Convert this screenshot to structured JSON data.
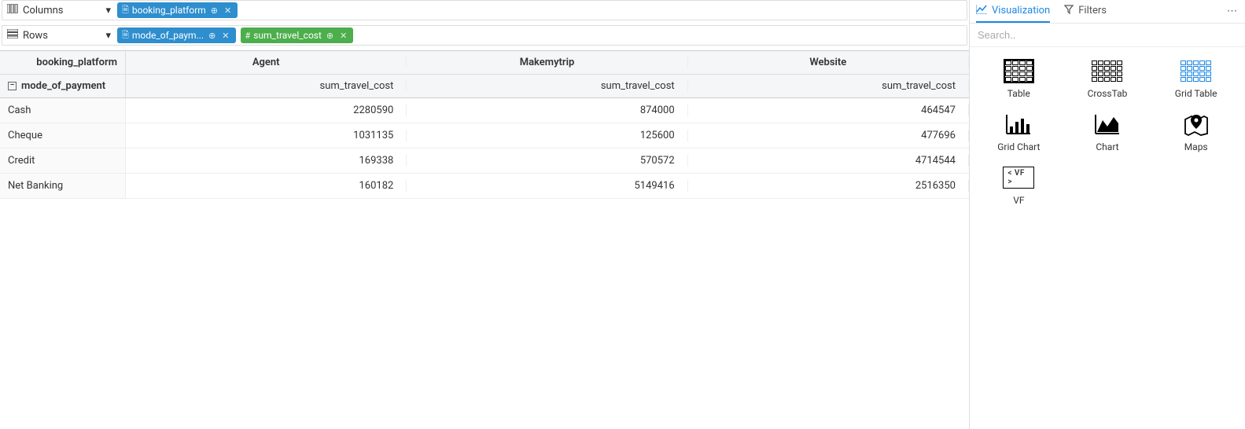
{
  "shelves": {
    "columns": {
      "label": "Columns",
      "pills": [
        {
          "text": "booking_platform",
          "color": "blue"
        }
      ]
    },
    "rows": {
      "label": "Rows",
      "pills": [
        {
          "text": "mode_of_paym...",
          "color": "blue"
        },
        {
          "text": "sum_travel_cost",
          "color": "green"
        }
      ]
    }
  },
  "crosstab": {
    "col_dimension": "booking_platform",
    "row_dimension": "mode_of_payment",
    "measure_label": "sum_travel_cost",
    "columns": [
      "Agent",
      "Makemytrip",
      "Website"
    ],
    "rows": [
      {
        "label": "Cash",
        "values": [
          "2280590",
          "874000",
          "464547"
        ]
      },
      {
        "label": "Cheque",
        "values": [
          "1031135",
          "125600",
          "477696"
        ]
      },
      {
        "label": "Credit",
        "values": [
          "169338",
          "570572",
          "4714544"
        ]
      },
      {
        "label": "Net Banking",
        "values": [
          "160182",
          "5149416",
          "2516350"
        ]
      }
    ]
  },
  "side": {
    "tabs": {
      "visualization": "Visualization",
      "filters": "Filters"
    },
    "search_placeholder": "Search..",
    "viz_types": {
      "table": "Table",
      "crosstab": "CrossTab",
      "gridtable": "Grid Table",
      "gridchart": "Grid Chart",
      "chart": "Chart",
      "maps": "Maps",
      "vf": "VF"
    },
    "vf_badge": "< VF >"
  },
  "chart_data": {
    "type": "table",
    "title": "sum_travel_cost by booking_platform and mode_of_payment",
    "xlabel": "booking_platform",
    "ylabel": "mode_of_payment",
    "columns": [
      "Agent",
      "Makemytrip",
      "Website"
    ],
    "categories": [
      "Cash",
      "Cheque",
      "Credit",
      "Net Banking"
    ],
    "series": [
      {
        "name": "Agent",
        "values": [
          2280590,
          1031135,
          169338,
          160182
        ]
      },
      {
        "name": "Makemytrip",
        "values": [
          874000,
          125600,
          570572,
          5149416
        ]
      },
      {
        "name": "Website",
        "values": [
          464547,
          477696,
          4714544,
          2516350
        ]
      }
    ]
  }
}
